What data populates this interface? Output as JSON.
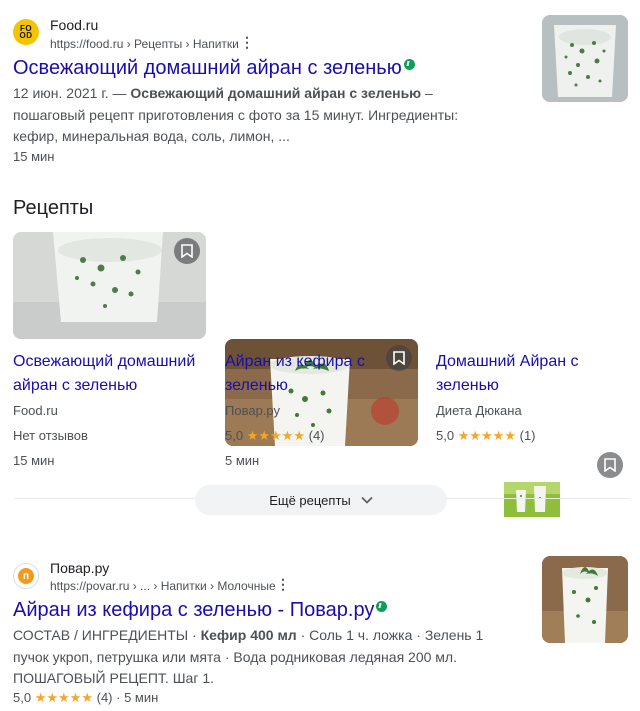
{
  "result1": {
    "site": "Food.ru",
    "favicon": [
      "FO",
      "OD"
    ],
    "breadcrumb": "https://food.ru › Рецепты › Напитки",
    "title": "Освежающий домашний айран с зеленью",
    "date": "12 июн. 2021 г. —",
    "snippet_bold": "Освежающий домашний айран с зеленью",
    "snippet_rest": " – пошаговый рецепт приготовления с фото за 15 минут. Ингредиенты: кефир, минеральная вода, соль, лимон, ...",
    "time": "15 мин"
  },
  "recipes": {
    "heading": "Рецепты",
    "cards": [
      {
        "title": "Освежающий домашний айран с зеленью",
        "source": "Food.ru",
        "rating": "Нет отзывов",
        "time": "15 мин"
      },
      {
        "title": "Айран из кефира с зеленью",
        "source": "Повар.ру",
        "score": "5,0",
        "stars": "★★★★★",
        "count": "(4)",
        "time": "5 мин"
      },
      {
        "title": "Домашний Айран с зеленью",
        "source": "Диета Дюкана",
        "score": "5,0",
        "stars": "★★★★★",
        "count": "(1)"
      }
    ],
    "more_label": "Ещё рецепты"
  },
  "result2": {
    "site": "Повар.ру",
    "favicon": "п",
    "breadcrumb": "https://povar.ru › ... › Напитки › Молочные",
    "title": "Айран из кефира с зеленью - Повар.ру",
    "snippet_a": "СОСТАВ / ИНГРЕДИЕНТЫ · ",
    "snippet_b": "Кефир 400 мл",
    "snippet_c": " · Соль 1 ч. ложка · Зелень 1 пучок укроп, петрушка или мята · Вода родниковая ледяная 200 мл. ПОШАГОВЫЙ РЕЦЕПТ. Шаг 1.",
    "score": "5,0",
    "stars": "★★★★★",
    "count": "(4)",
    "time": "· 5 мин"
  },
  "colors": {
    "link": "#1a0dab",
    "star": "#f5a623",
    "amp": "#0f9d58"
  }
}
